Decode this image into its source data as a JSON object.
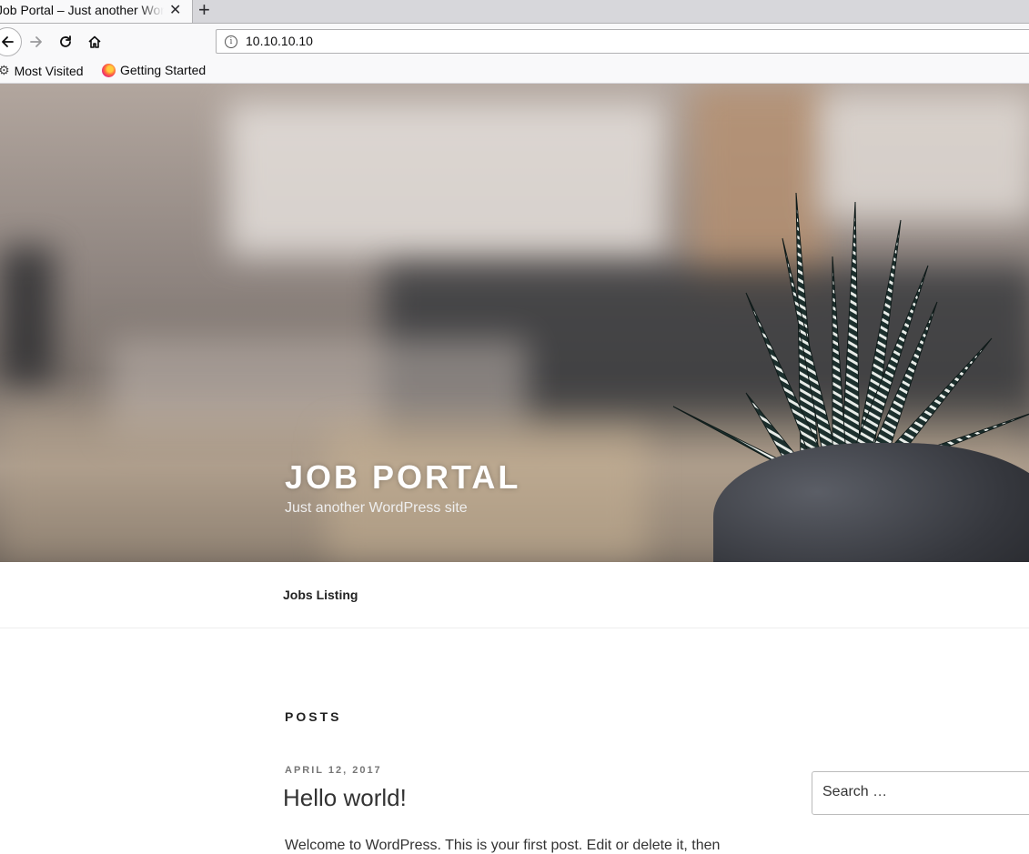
{
  "browser": {
    "tab_title": "Job Portal – Just another WordPress site",
    "close_glyph": "✕",
    "new_tab_glyph": "+",
    "url": "10.10.10.10",
    "info_glyph": "i",
    "bookmarks": [
      {
        "label": "Most Visited",
        "icon": "gear-icon"
      },
      {
        "label": "Getting Started",
        "icon": "firefox-icon"
      }
    ]
  },
  "site": {
    "title": "JOB PORTAL",
    "description": "Just another WordPress site",
    "menu": [
      "Jobs Listing"
    ]
  },
  "content": {
    "heading": "POSTS",
    "post": {
      "date": "APRIL 12, 2017",
      "title": "Hello world!",
      "excerpt": "Welcome to WordPress. This is your first post. Edit or delete it, then"
    }
  },
  "sidebar": {
    "search_placeholder": "Search …"
  },
  "colors": {
    "chrome_bg": "#f9f9fa",
    "tabbar_bg": "#d7d7db",
    "text": "#222222",
    "date_gray": "#767676"
  }
}
